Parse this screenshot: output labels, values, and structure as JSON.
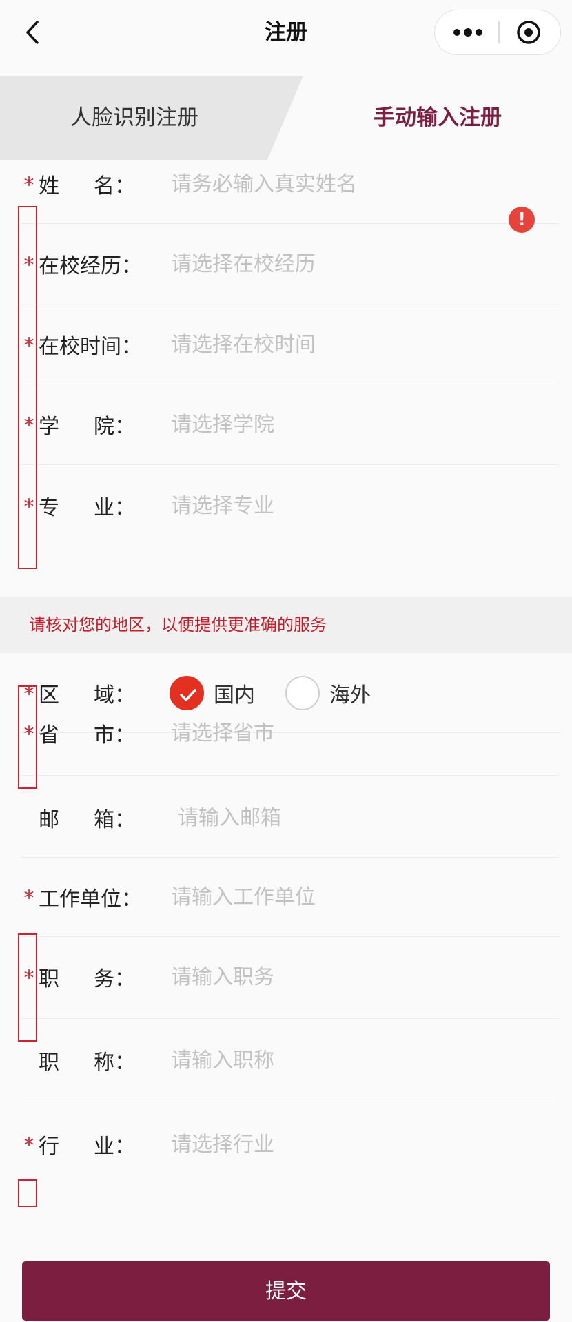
{
  "nav": {
    "title": "注册"
  },
  "tabs": {
    "face": "人脸识别注册",
    "manual": "手动输入注册"
  },
  "section1": [
    {
      "key": "name",
      "required": true,
      "label_chars": [
        "姓",
        "名："
      ],
      "placeholder": "请务必输入真实姓名",
      "error": true
    },
    {
      "key": "history",
      "required": true,
      "label_chars": [
        "在校经历："
      ],
      "placeholder": "请选择在校经历"
    },
    {
      "key": "time",
      "required": true,
      "label_chars": [
        "在校时间："
      ],
      "placeholder": "请选择在校时间"
    },
    {
      "key": "college",
      "required": true,
      "label_chars": [
        "学",
        "院："
      ],
      "placeholder": "请选择学院"
    },
    {
      "key": "major",
      "required": true,
      "label_chars": [
        "专",
        "业："
      ],
      "placeholder": "请选择专业"
    }
  ],
  "notice": "请核对您的地区，以便提供更准确的服务",
  "region": {
    "label_chars": [
      "区",
      "域："
    ],
    "options": [
      {
        "label": "国内",
        "checked": true
      },
      {
        "label": "海外",
        "checked": false
      }
    ]
  },
  "section2": [
    {
      "key": "province",
      "required": true,
      "label_chars": [
        "省",
        "市："
      ],
      "placeholder": "请选择省市"
    },
    {
      "key": "email",
      "required": false,
      "label_chars": [
        "邮",
        "箱："
      ],
      "placeholder": "请输入邮箱"
    },
    {
      "key": "company",
      "required": true,
      "label_chars": [
        "工作单位："
      ],
      "placeholder": "请输入工作单位"
    },
    {
      "key": "position",
      "required": true,
      "label_chars": [
        "职",
        "务："
      ],
      "placeholder": "请输入职务"
    },
    {
      "key": "title",
      "required": false,
      "label_chars": [
        "职",
        "称："
      ],
      "placeholder": "请输入职称"
    },
    {
      "key": "industry",
      "required": true,
      "label_chars": [
        "行",
        "业："
      ],
      "placeholder": "请选择行业"
    }
  ],
  "required_mark": "*",
  "error_icon": "!",
  "submit": "提交",
  "colors": {
    "brand": "#7c1e40",
    "required": "#d3202f",
    "checked": "#e33021",
    "error": "#e5433c"
  }
}
